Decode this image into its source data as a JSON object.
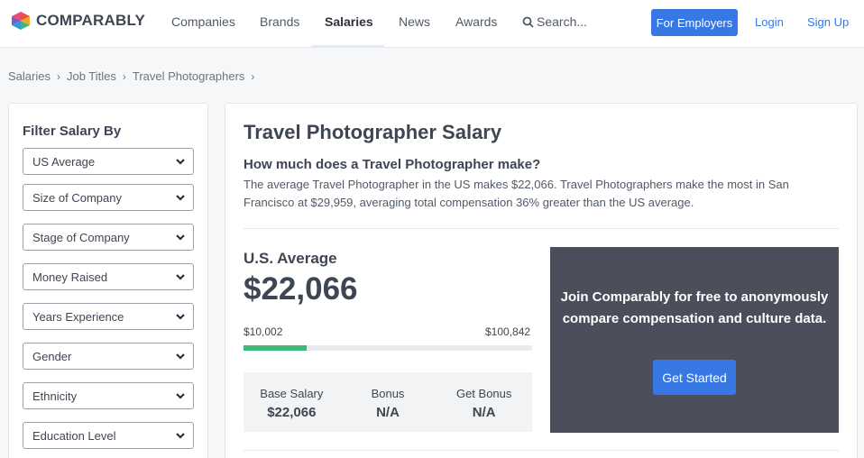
{
  "header": {
    "logo_text": "COMPARABLY",
    "nav": [
      {
        "label": "Companies",
        "active": false
      },
      {
        "label": "Brands",
        "active": false
      },
      {
        "label": "Salaries",
        "active": true
      },
      {
        "label": "News",
        "active": false
      },
      {
        "label": "Awards",
        "active": false
      }
    ],
    "search_label": "Search...",
    "employers_button": "For Employers",
    "login": "Login",
    "signup": "Sign Up"
  },
  "breadcrumb": [
    "Salaries",
    "Job Titles",
    "Travel Photographers"
  ],
  "sidebar": {
    "title": "Filter Salary By",
    "filters": [
      "US Average",
      "Size of Company",
      "Stage of Company",
      "Money Raised",
      "Years Experience",
      "Gender",
      "Ethnicity",
      "Education Level"
    ]
  },
  "main": {
    "title": "Travel Photographer Salary",
    "subhead": "How much does a Travel Photographer make?",
    "description": "The average Travel Photographer in the US makes $22,066. Travel Photographers make the most in San Francisco at $29,959, averaging total compensation 36% greater than the US average.",
    "avg_label": "U.S. Average",
    "avg_value": "$22,066",
    "range_min": "$10,002",
    "range_max": "$100,842",
    "range_fill_fraction": 0.22,
    "stats": [
      {
        "label": "Base Salary",
        "value": "$22,066"
      },
      {
        "label": "Bonus",
        "value": "N/A"
      },
      {
        "label": "Get Bonus",
        "value": "N/A"
      }
    ],
    "promo_text": "Join Comparably for free to anonymously compare compensation and culture data.",
    "promo_button": "Get Started"
  },
  "colors": {
    "accent": "#3878e4",
    "promo_bg": "#4a4f5b",
    "range_fill": "#3db77a"
  }
}
